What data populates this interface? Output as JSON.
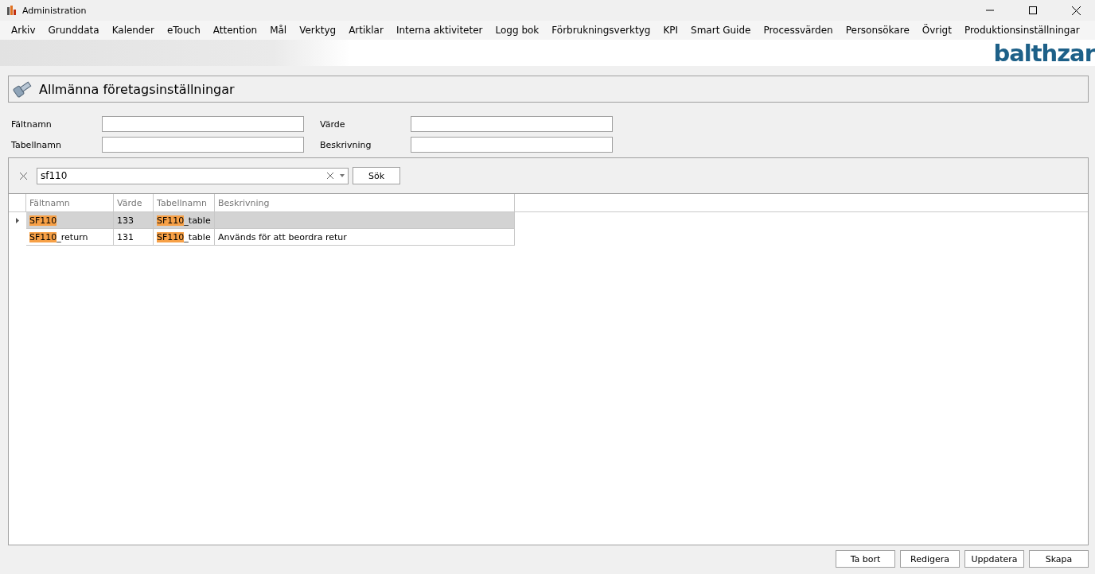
{
  "window": {
    "title": "Administration"
  },
  "menu": [
    "Arkiv",
    "Grunddata",
    "Kalender",
    "eTouch",
    "Attention",
    "Mål",
    "Verktyg",
    "Artiklar",
    "Interna aktiviteter",
    "Logg bok",
    "Förbrukningsverktyg",
    "KPI",
    "Smart Guide",
    "Processvärden",
    "Personsökare",
    "Övrigt",
    "Produktionsinställningar"
  ],
  "logo": "balthzar",
  "page_title": "Allmänna företagsinställningar",
  "filters": [
    {
      "label": "Fältnamn"
    },
    {
      "label": "Värde"
    },
    {
      "label": "Tabellnamn"
    },
    {
      "label": "Beskrivning"
    }
  ],
  "search": {
    "value": "sf110",
    "button": "Sök"
  },
  "table": {
    "columns": [
      "Fältnamn",
      "Värde",
      "Tabellnamn",
      "Beskrivning"
    ],
    "rows": [
      {
        "selected": true,
        "cells": [
          [
            {
              "text": "SF110",
              "highlighted": true
            }
          ],
          [
            {
              "text": "133",
              "highlighted": false
            }
          ],
          [
            {
              "text": "SF110",
              "highlighted": true
            },
            {
              "text": "_table",
              "highlighted": false
            }
          ],
          []
        ]
      },
      {
        "selected": false,
        "cells": [
          [
            {
              "text": "SF110",
              "highlighted": true
            },
            {
              "text": "_return",
              "highlighted": false
            }
          ],
          [
            {
              "text": "131",
              "highlighted": false
            }
          ],
          [
            {
              "text": "SF110",
              "highlighted": true
            },
            {
              "text": "_table",
              "highlighted": false
            }
          ],
          [
            {
              "text": "Används för att beordra retur",
              "highlighted": false
            }
          ]
        ]
      }
    ]
  },
  "buttons": [
    "Ta bort",
    "Redigera",
    "Uppdatera",
    "Skapa"
  ]
}
